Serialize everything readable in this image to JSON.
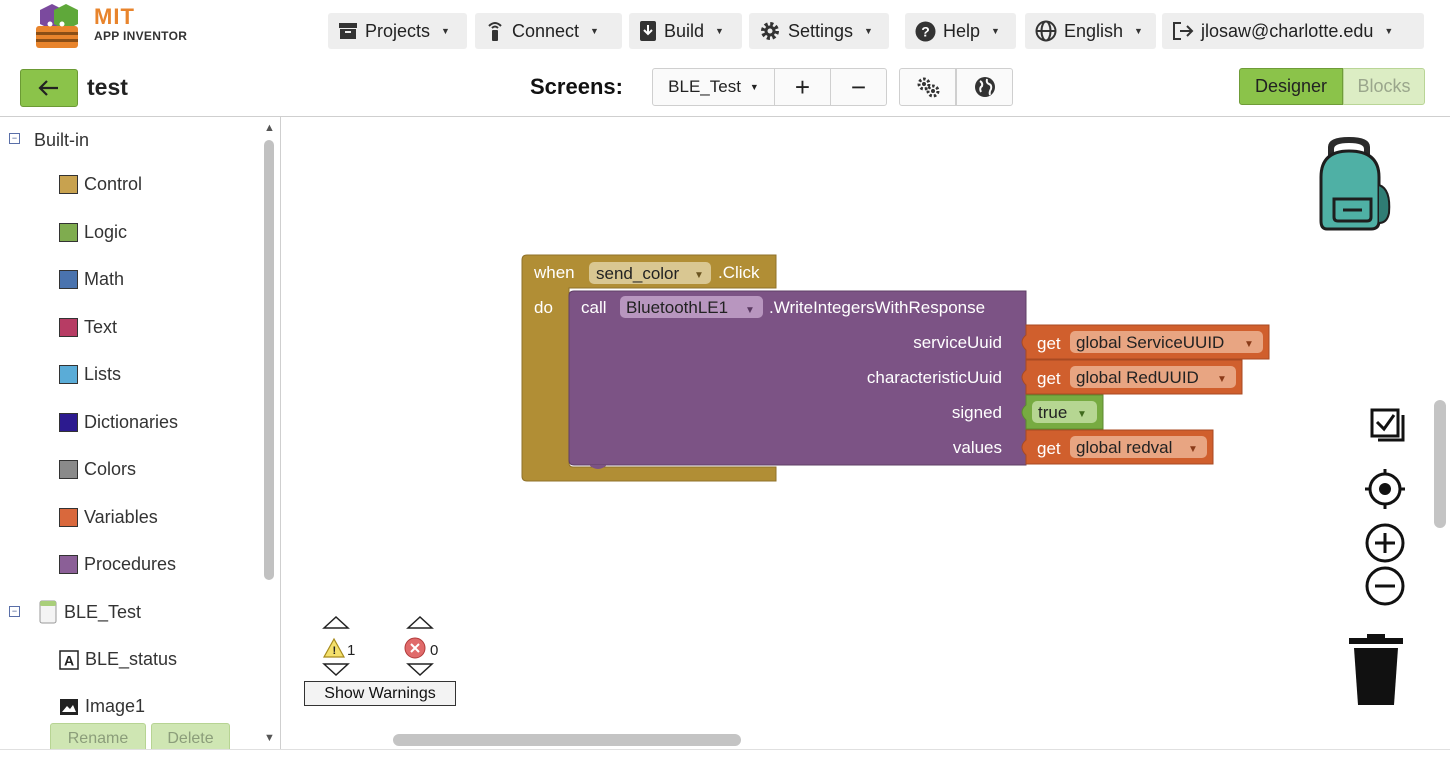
{
  "header": {
    "logo": {
      "line1": "MIT",
      "line2": "APP INVENTOR"
    },
    "menus": [
      {
        "label": "Projects",
        "icon": "projects-icon"
      },
      {
        "label": "Connect",
        "icon": "connect-icon"
      },
      {
        "label": "Build",
        "icon": "build-icon"
      },
      {
        "label": "Settings",
        "icon": "gear-icon"
      },
      {
        "label": "Help",
        "icon": "help-icon"
      },
      {
        "label": "English",
        "icon": "globe-icon"
      },
      {
        "label": "jlosaw@charlotte.edu",
        "icon": "logout-icon"
      }
    ]
  },
  "project_bar": {
    "project_name": "test",
    "screens_label": "Screens:",
    "current_screen": "BLE_Test",
    "add_screen": "+",
    "remove_screen": "−",
    "designer": "Designer",
    "blocks": "Blocks"
  },
  "tree": {
    "builtin": "Built-in",
    "categories": [
      {
        "label": "Control",
        "color": "#c8a24f"
      },
      {
        "label": "Logic",
        "color": "#7fac4f"
      },
      {
        "label": "Math",
        "color": "#4a73ae"
      },
      {
        "label": "Text",
        "color": "#b73c64"
      },
      {
        "label": "Lists",
        "color": "#5aacd7"
      },
      {
        "label": "Dictionaries",
        "color": "#2c1a8f"
      },
      {
        "label": "Colors",
        "color": "#8a8a8a"
      },
      {
        "label": "Variables",
        "color": "#d9683c"
      },
      {
        "label": "Procedures",
        "color": "#8b5f97"
      }
    ],
    "screen": "BLE_Test",
    "components": [
      {
        "label": "BLE_status",
        "icon": "label-icon"
      },
      {
        "label": "Image1",
        "icon": "image-icon"
      }
    ],
    "rename": "Rename",
    "delete": "Delete"
  },
  "blocks": {
    "event": {
      "when": "when",
      "component": "send_color",
      "event": ".Click",
      "do": "do"
    },
    "call": {
      "call": "call",
      "component": "BluetoothLE1",
      "method": ".WriteIntegersWithResponse",
      "args": [
        {
          "name": "serviceUuid",
          "get": "get",
          "value": "global ServiceUUID"
        },
        {
          "name": "characteristicUuid",
          "get": "get",
          "value": "global RedUUID"
        },
        {
          "name": "signed",
          "value": "true"
        },
        {
          "name": "values",
          "get": "get",
          "value": "global redval"
        }
      ]
    },
    "colors": {
      "event": "#b18e35",
      "call": "#7c5385",
      "variable": "#d05f2d",
      "logic": "#77ab41"
    }
  },
  "warnings": {
    "warning_count": "1",
    "error_count": "0",
    "toggle": "Show Warnings"
  }
}
